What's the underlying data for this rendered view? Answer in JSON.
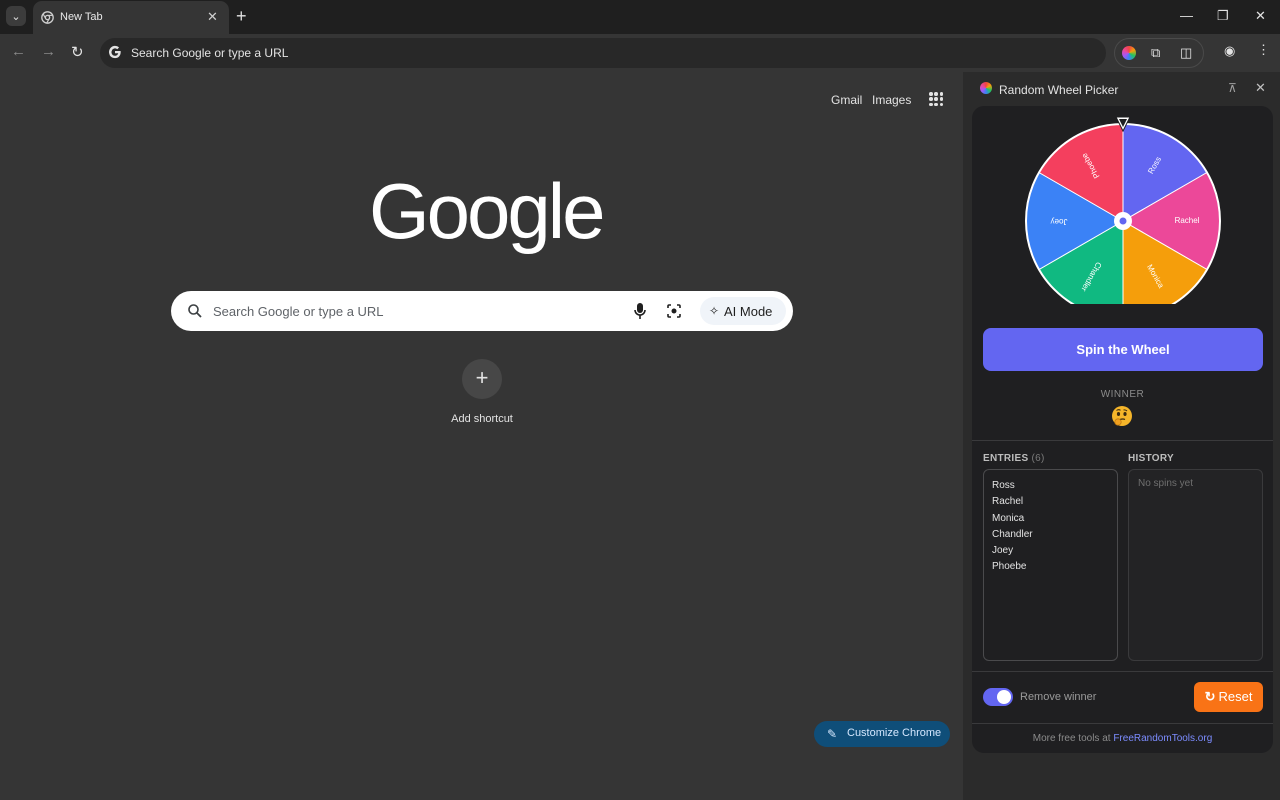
{
  "browser": {
    "tab": {
      "title": "New Tab"
    },
    "omnibox": {
      "placeholder": "Search Google or type a URL"
    }
  },
  "ntp": {
    "links": {
      "gmail": "Gmail",
      "images": "Images"
    },
    "logo": "Google",
    "search": {
      "placeholder": "Search Google or type a URL",
      "ai_mode": "AI Mode"
    },
    "shortcut": {
      "label": "Add shortcut",
      "icon": "+"
    },
    "customize": "Customize Chrome"
  },
  "side_panel": {
    "title": "Random Wheel Picker",
    "wheel": {
      "segments": [
        {
          "label": "Ross",
          "color": "#6366f1"
        },
        {
          "label": "Rachel",
          "color": "#ec4899"
        },
        {
          "label": "Monica",
          "color": "#f59e0b"
        },
        {
          "label": "Chandler",
          "color": "#10b981"
        },
        {
          "label": "Joey",
          "color": "#3b82f6"
        },
        {
          "label": "Phoebe",
          "color": "#f43f5e"
        }
      ]
    },
    "spin_button": "Spin the Wheel",
    "winner_label": "WINNER",
    "winner_value": "🤔",
    "entries_label": "ENTRIES",
    "entries_count": "(6)",
    "entries": [
      "Ross",
      "Rachel",
      "Monica",
      "Chandler",
      "Joey",
      "Phoebe"
    ],
    "history_label": "HISTORY",
    "history_empty": "No spins yet",
    "remove_winner": "Remove winner",
    "reset_button": "Reset",
    "footer_prefix": "More free tools at ",
    "footer_link": "FreeRandomTools.org"
  }
}
